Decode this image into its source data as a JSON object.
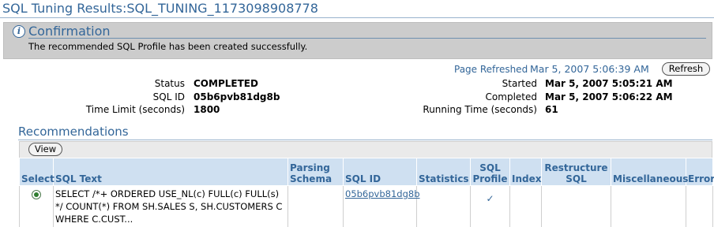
{
  "page": {
    "title": "SQL Tuning Results:SQL_TUNING_1173098908778"
  },
  "confirmation": {
    "heading": "Confirmation",
    "message": "The recommended SQL Profile has been created successfully.",
    "icon": "info-icon"
  },
  "refresh": {
    "label": "Page Refreshed",
    "value": "Mar 5, 2007 5:06:39 AM",
    "button_label": "Refresh"
  },
  "details_left": [
    {
      "label": "Status",
      "value": "COMPLETED"
    },
    {
      "label": "SQL ID",
      "value": "05b6pvb81dg8b"
    },
    {
      "label": "Time Limit (seconds)",
      "value": "1800"
    }
  ],
  "details_right": [
    {
      "label": "Started",
      "value": "Mar 5, 2007 5:05:21 AM"
    },
    {
      "label": "Completed",
      "value": "Mar 5, 2007 5:06:22 AM"
    },
    {
      "label": "Running Time (seconds)",
      "value": "61"
    }
  ],
  "recommendations": {
    "heading": "Recommendations",
    "view_button": "View",
    "columns": {
      "select": "Select",
      "sql_text": "SQL Text",
      "parsing_schema": "Parsing Schema",
      "sql_id": "SQL ID",
      "statistics": "Statistics",
      "sql_profile": "SQL Profile",
      "index": "Index",
      "restructure_sql": "Restructure SQL",
      "miscellaneous": "Miscellaneous",
      "error": "Error"
    },
    "rows": [
      {
        "selected": true,
        "sql_text": "SELECT /*+ ORDERED USE_NL(c) FULL(c) FULL(s) */ COUNT(*) FROM SH.SALES S, SH.CUSTOMERS C WHERE C.CUST...",
        "parsing_schema": "",
        "sql_id": "05b6pvb81dg8b",
        "statistics": "",
        "sql_profile": "✓",
        "index": "",
        "restructure_sql": "",
        "miscellaneous": "",
        "error": ""
      }
    ]
  },
  "colors": {
    "accent": "#336699",
    "header_bg": "#cfe0f1",
    "confirmation_bg": "#cccccc"
  }
}
